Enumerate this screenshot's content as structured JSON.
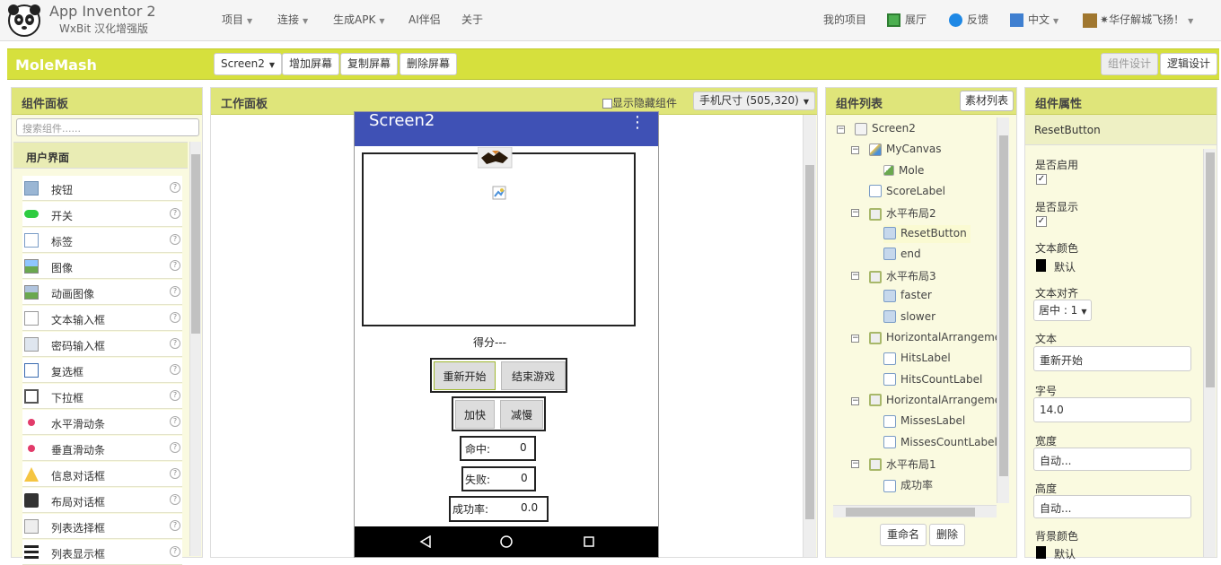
{
  "app": {
    "title": "App Inventor 2",
    "subtitle": "WxBit 汉化增强版"
  },
  "menu": {
    "project": "项目",
    "connect": "连接",
    "build": "生成APK",
    "ai": "AI伴侣",
    "about": "关于"
  },
  "user_menu": {
    "my_projects": "我的项目",
    "gallery": "展厅",
    "feedback": "反馈",
    "language": "中文",
    "user": "华仔解城飞扬！"
  },
  "toolbar": {
    "project_name": "MoleMash",
    "screen_select": "Screen2",
    "add_screen": "增加屏幕",
    "copy_screen": "复制屏幕",
    "delete_screen": "删除屏幕",
    "designer": "组件设计",
    "blocks": "逻辑设计"
  },
  "palette": {
    "title": "组件面板",
    "search_placeholder": "搜索组件......",
    "category": "用户界面",
    "items": [
      {
        "label": "按钮",
        "icon": "button-icon"
      },
      {
        "label": "开关",
        "icon": "switch-icon"
      },
      {
        "label": "标签",
        "icon": "label-icon"
      },
      {
        "label": "图像",
        "icon": "image-icon"
      },
      {
        "label": "动画图像",
        "icon": "animated-image-icon"
      },
      {
        "label": "文本输入框",
        "icon": "textbox-icon"
      },
      {
        "label": "密码输入框",
        "icon": "password-icon"
      },
      {
        "label": "复选框",
        "icon": "checkbox-icon"
      },
      {
        "label": "下拉框",
        "icon": "spinner-icon"
      },
      {
        "label": "水平滑动条",
        "icon": "horizontal-slider-icon"
      },
      {
        "label": "垂直滑动条",
        "icon": "vertical-slider-icon"
      },
      {
        "label": "信息对话框",
        "icon": "notifier-icon"
      },
      {
        "label": "布局对话框",
        "icon": "layout-dialog-icon"
      },
      {
        "label": "列表选择框",
        "icon": "listpicker-icon"
      },
      {
        "label": "列表显示框",
        "icon": "listview-icon"
      }
    ],
    "help_glyph": "?"
  },
  "viewer": {
    "title": "工作面板",
    "show_hidden": "显示隐藏组件",
    "device_size": "手机尺寸 (505,320)",
    "screen_title": "Screen2",
    "score_label": "得分---",
    "restart": "重新开始",
    "end_game": "结束游戏",
    "faster": "加快",
    "slower": "减慢",
    "hits_label": "命中:",
    "hits_value": "0",
    "misses_label": "失败:",
    "misses_value": "0",
    "rate_label": "成功率:",
    "rate_value": "0.0"
  },
  "tree": {
    "title": "组件列表",
    "media_button": "素材列表",
    "rename": "重命名",
    "delete": "删除",
    "nodes": [
      {
        "label": "Screen2",
        "icon": "screen-icon",
        "level": 0,
        "toggle": "minus"
      },
      {
        "label": "MyCanvas",
        "icon": "canvas-icon",
        "level": 1,
        "toggle": "minus"
      },
      {
        "label": "Mole",
        "icon": "sprite-icon",
        "level": 2,
        "toggle": ""
      },
      {
        "label": "ScoreLabel",
        "icon": "label-icon",
        "level": 1,
        "toggle": ""
      },
      {
        "label": "水平布局2",
        "icon": "arrangement-icon",
        "level": 1,
        "toggle": "minus"
      },
      {
        "label": "ResetButton",
        "icon": "button-icon",
        "level": 2,
        "toggle": "",
        "selected": true
      },
      {
        "label": "end",
        "icon": "button-icon",
        "level": 2,
        "toggle": ""
      },
      {
        "label": "水平布局3",
        "icon": "arrangement-icon",
        "level": 1,
        "toggle": "minus"
      },
      {
        "label": "faster",
        "icon": "button-icon",
        "level": 2,
        "toggle": ""
      },
      {
        "label": "slower",
        "icon": "button-icon",
        "level": 2,
        "toggle": ""
      },
      {
        "label": "HorizontalArrangemer",
        "icon": "arrangement-icon",
        "level": 1,
        "toggle": "minus"
      },
      {
        "label": "HitsLabel",
        "icon": "label-icon",
        "level": 2,
        "toggle": ""
      },
      {
        "label": "HitsCountLabel",
        "icon": "label-icon",
        "level": 2,
        "toggle": ""
      },
      {
        "label": "HorizontalArrangemer",
        "icon": "arrangement-icon",
        "level": 1,
        "toggle": "minus"
      },
      {
        "label": "MissesLabel",
        "icon": "label-icon",
        "level": 2,
        "toggle": ""
      },
      {
        "label": "MissesCountLabel",
        "icon": "label-icon",
        "level": 2,
        "toggle": ""
      },
      {
        "label": "水平布局1",
        "icon": "arrangement-icon",
        "level": 1,
        "toggle": "minus"
      },
      {
        "label": "成功率",
        "icon": "label-icon",
        "level": 2,
        "toggle": ""
      }
    ]
  },
  "properties": {
    "title": "组件属性",
    "component": "ResetButton",
    "enabled_label": "是否启用",
    "visible_label": "是否显示",
    "text_color_label": "文本颜色",
    "text_color_value": "默认",
    "text_align_label": "文本对齐",
    "text_align_value": "居中 : 1",
    "text_label": "文本",
    "text_value": "重新开始",
    "font_size_label": "字号",
    "font_size_value": "14.0",
    "width_label": "宽度",
    "width_value": "自动...",
    "height_label": "高度",
    "height_value": "自动...",
    "bg_color_label": "背景颜色",
    "bg_color_value": "默认"
  },
  "colors": {
    "toolbar": "#d6e03d",
    "panel_head": "#dfe57a",
    "screen_bar": "#3f51b5",
    "selected": "#fafad2"
  }
}
